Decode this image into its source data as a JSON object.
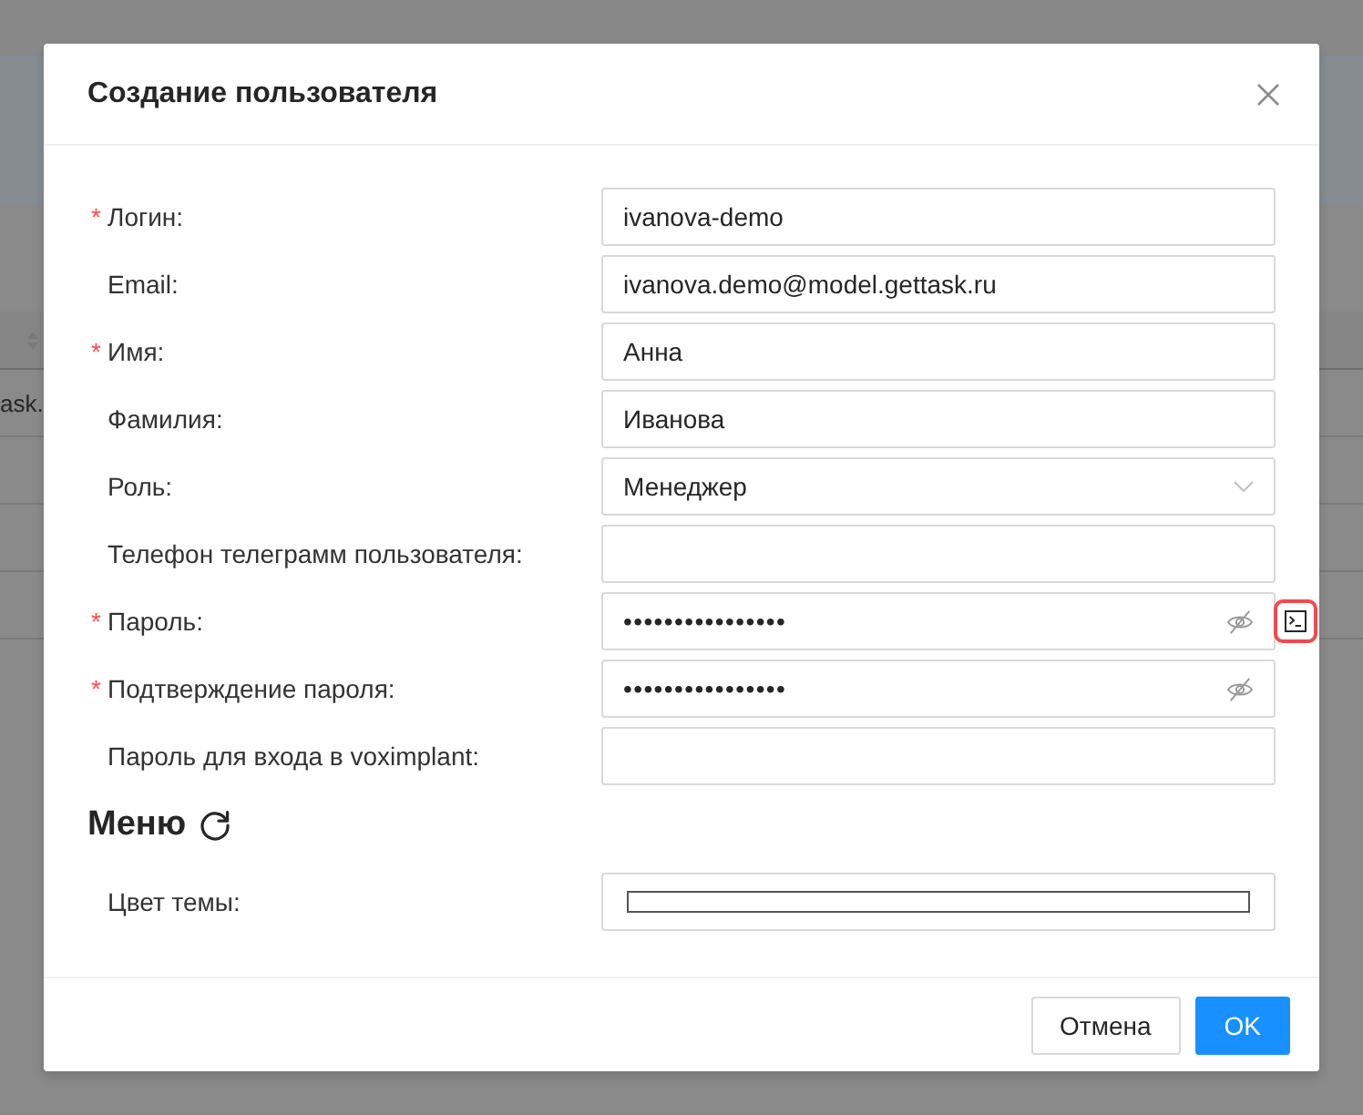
{
  "background": {
    "cell_text": "ask."
  },
  "dialog": {
    "title": "Создание пользователя",
    "required_mark": "*",
    "fields": [
      {
        "kind": "text",
        "label": "Логин:",
        "required": true,
        "value": "ivanova-demo"
      },
      {
        "kind": "text",
        "label": "Email:",
        "required": false,
        "value": "ivanova.demo@model.gettask.ru"
      },
      {
        "kind": "text",
        "label": "Имя:",
        "required": true,
        "value": "Анна"
      },
      {
        "kind": "text",
        "label": "Фамилия:",
        "required": false,
        "value": "Иванова"
      },
      {
        "kind": "select",
        "label": "Роль:",
        "required": false,
        "value": "Менеджер"
      },
      {
        "kind": "text",
        "label": "Телефон телеграмм пользователя:",
        "required": false
      },
      {
        "kind": "password",
        "label": "Пароль:",
        "required": true,
        "value": "••••••••••••••••",
        "revealed": false,
        "side_button": {
          "highlighted": true
        }
      },
      {
        "kind": "password",
        "label": "Подтверждение пароля:",
        "required": true,
        "value": "••••••••••••••••",
        "revealed": false
      },
      {
        "kind": "text",
        "label": "Пароль для входа в voximplant:",
        "required": false
      }
    ],
    "menu_section": {
      "title": "Меню",
      "fields": [
        {
          "kind": "color",
          "label": "Цвет темы:",
          "required": false,
          "color": "#ffffff"
        }
      ]
    },
    "buttons": [
      {
        "kind": "default",
        "label": "Отмена"
      },
      {
        "kind": "primary",
        "label": "OK"
      }
    ]
  }
}
